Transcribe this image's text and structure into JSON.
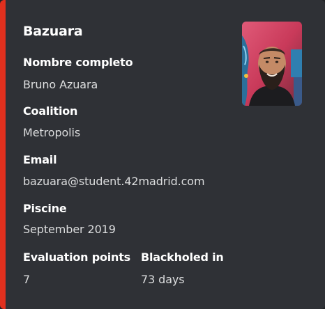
{
  "embed": {
    "author": "Bazuara",
    "accent_color": "#e0301e",
    "thumbnail": "profile-photo",
    "fields": [
      {
        "name": "Nombre completo",
        "value": "Bruno Azuara"
      },
      {
        "name": "Coalition",
        "value": "Metropolis"
      },
      {
        "name": "Email",
        "value": "bazuara@student.42madrid.com"
      },
      {
        "name": "Piscine",
        "value": "September 2019"
      },
      {
        "name": "Evaluation points",
        "value": "7"
      },
      {
        "name": "Blackholed in",
        "value": "73 days"
      }
    ]
  }
}
